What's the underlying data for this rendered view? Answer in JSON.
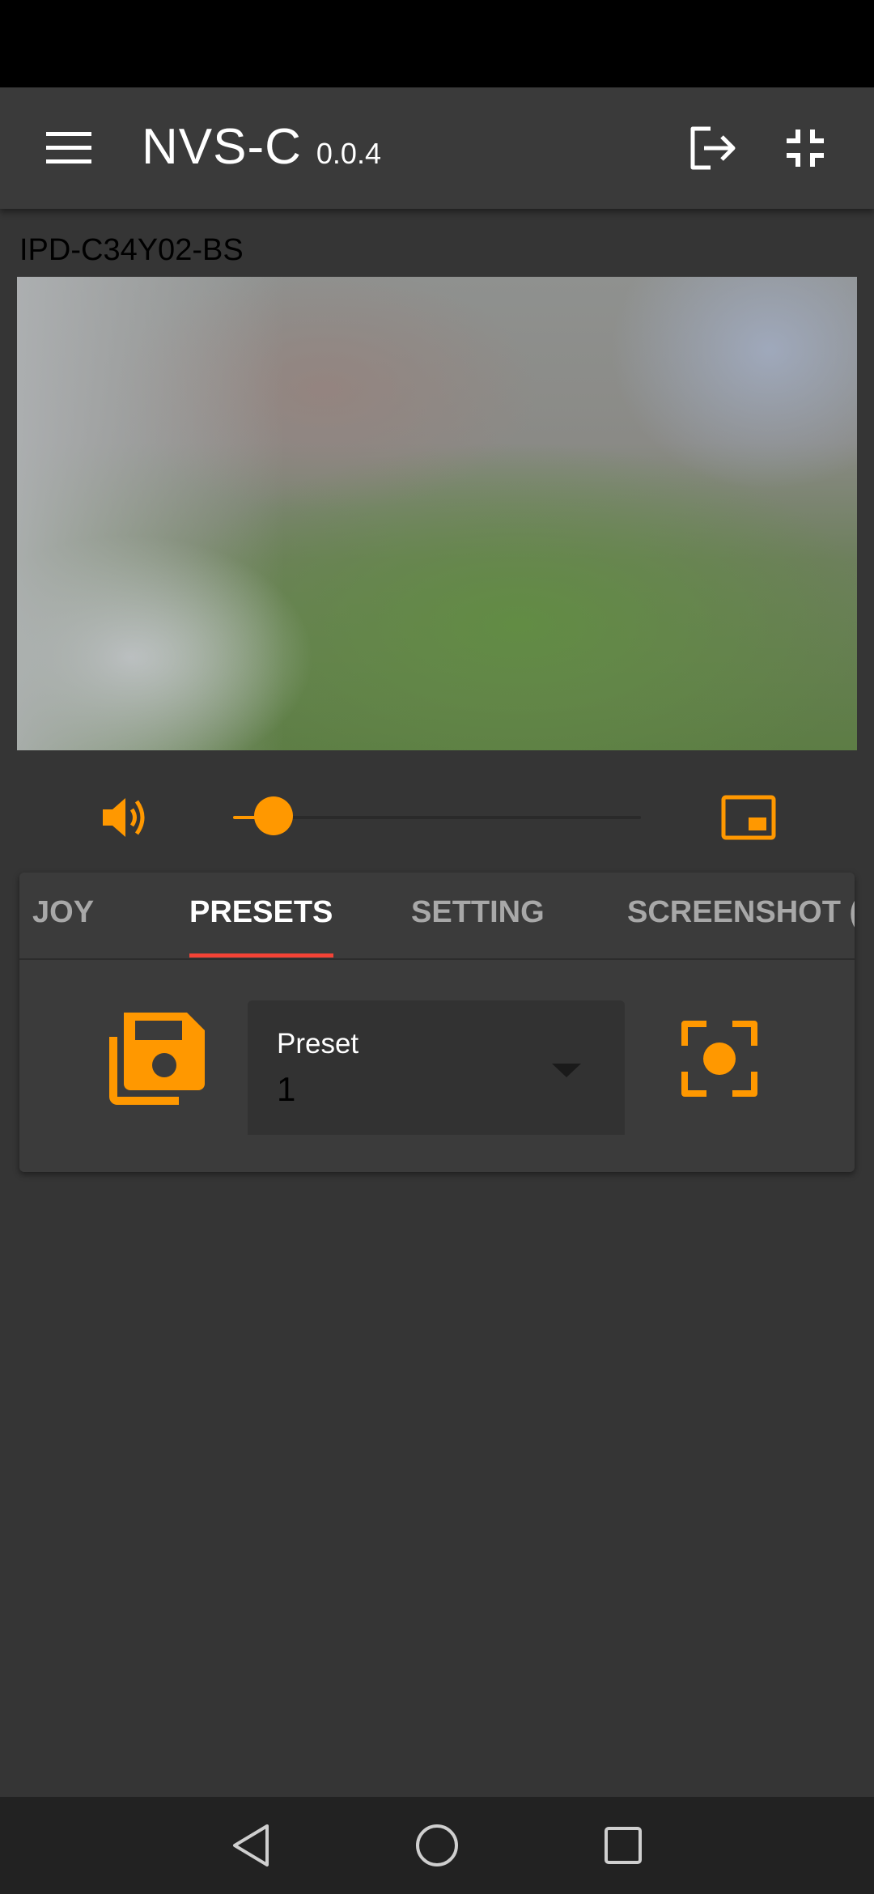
{
  "app_bar": {
    "title": "NVS-C",
    "version": "0.0.4"
  },
  "camera": {
    "name": "IPD-C34Y02-BS"
  },
  "volume": {
    "level": 0.1
  },
  "tabs": [
    {
      "label": "JOY",
      "active": false
    },
    {
      "label": "PRESETS",
      "active": true
    },
    {
      "label": "SETTING",
      "active": false
    },
    {
      "label": "SCREENSHOT (",
      "active": false
    }
  ],
  "presets": {
    "select_label": "Preset",
    "selected_value": "1"
  },
  "icons": {
    "menu": "menu-icon",
    "logout": "logout-icon",
    "fullscreen_exit": "fullscreen-exit-icon",
    "volume": "volume-icon",
    "pip": "picture-in-picture-icon",
    "save": "save-icon",
    "focus": "center-focus-icon",
    "nav_back": "back-icon",
    "nav_home": "home-icon",
    "nav_recents": "recents-icon"
  },
  "colors": {
    "accent": "#ff9800",
    "tab_indicator": "#f44336",
    "background": "#353535",
    "app_bar": "#3a3a3a"
  }
}
